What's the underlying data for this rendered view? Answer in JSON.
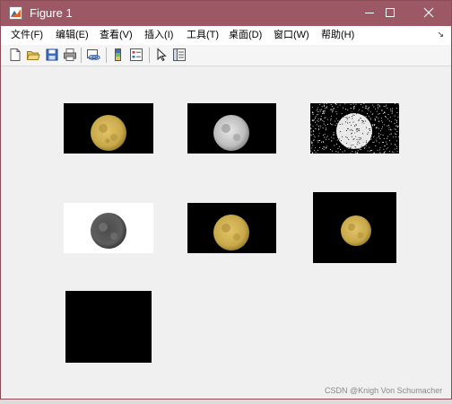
{
  "window": {
    "title": "Figure 1",
    "titlebar_color": "#9c5865"
  },
  "menubar": {
    "items": [
      {
        "label": "文件(F)"
      },
      {
        "label": "编辑(E)"
      },
      {
        "label": "查看(V)"
      },
      {
        "label": "插入(I)"
      },
      {
        "label": "工具(T)"
      },
      {
        "label": "桌面(D)"
      },
      {
        "label": "窗口(W)"
      },
      {
        "label": "帮助(H)"
      }
    ]
  },
  "toolbar": {
    "icons": [
      "new-figure-icon",
      "open-file-icon",
      "save-icon",
      "print-icon",
      "link-plot-icon",
      "colorbar-icon",
      "legend-icon",
      "pointer-icon",
      "property-inspector-icon"
    ]
  },
  "figure": {
    "panels": [
      {
        "name": "moon-color-original",
        "kind": "color"
      },
      {
        "name": "moon-grayscale",
        "kind": "gray"
      },
      {
        "name": "moon-noise",
        "kind": "noise"
      },
      {
        "name": "moon-inverted",
        "kind": "inverted"
      },
      {
        "name": "moon-color-copy",
        "kind": "color"
      },
      {
        "name": "moon-color-square",
        "kind": "color"
      },
      {
        "name": "black-image",
        "kind": "black"
      }
    ],
    "moon_color": "#c9a94a",
    "background": "#000000"
  },
  "watermark": "CSDN @Knigh Von Schumacher"
}
